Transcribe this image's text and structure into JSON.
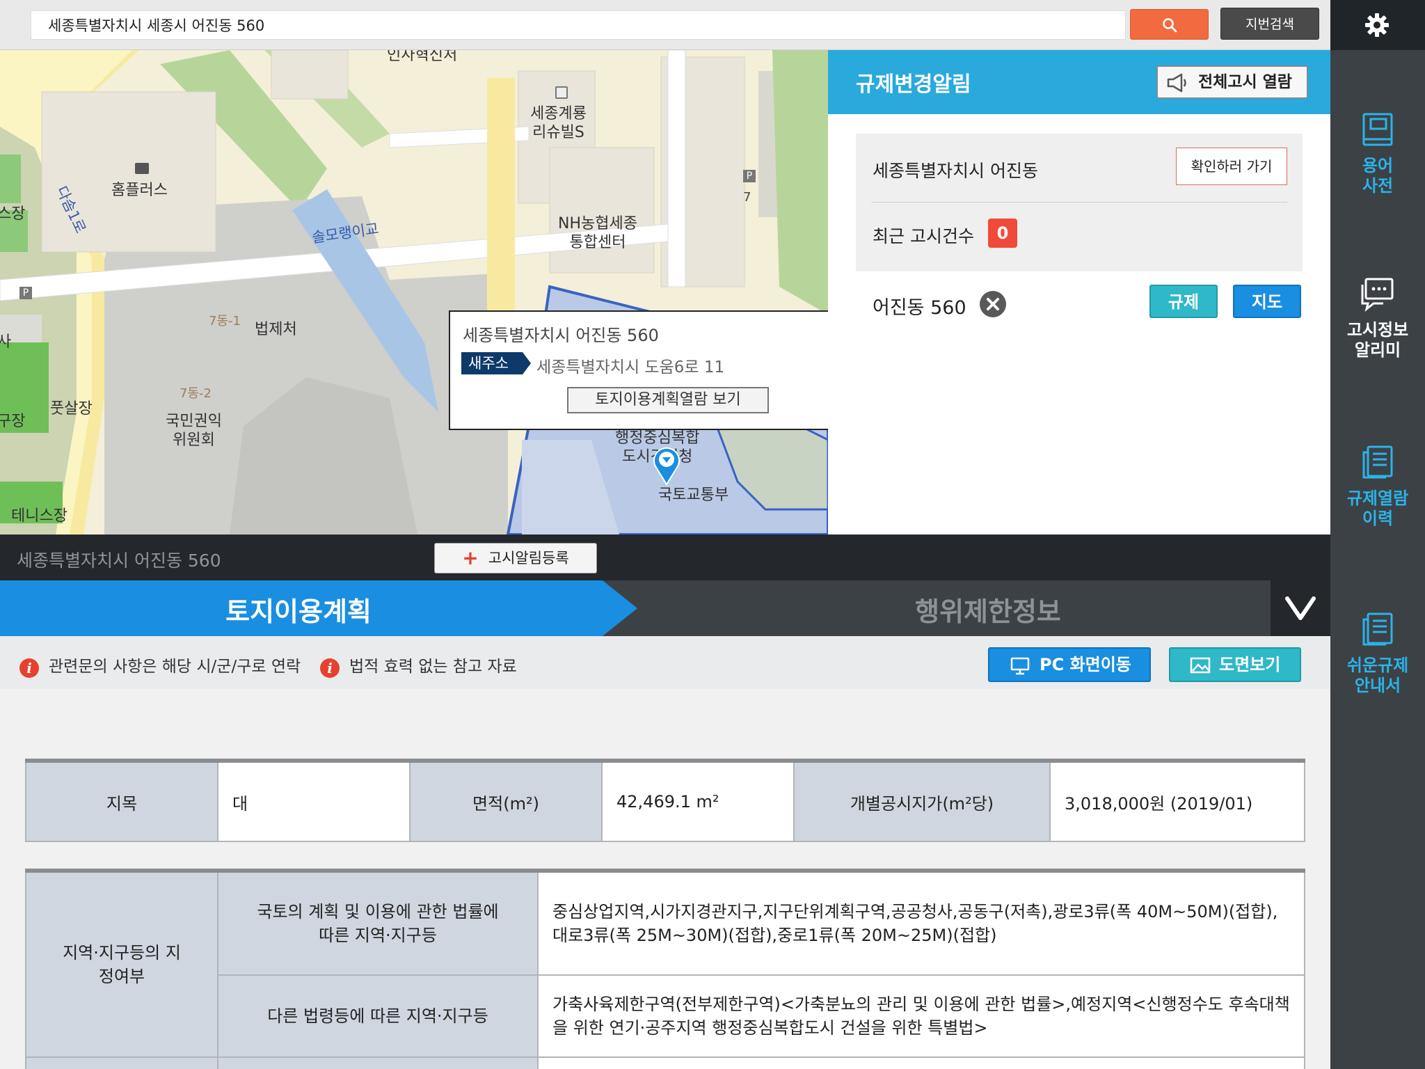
{
  "search": {
    "value": "세종특별자치시 세종시 어진동 560",
    "lot_search_label": "지번검색"
  },
  "right_nav": {
    "items": [
      {
        "label": "용어\n사전",
        "icon": "book-icon"
      },
      {
        "label": "고시정보\n알리미",
        "icon": "speech-bubble-icon"
      },
      {
        "label": "규제열람\n이력",
        "icon": "document-list-icon"
      },
      {
        "label": "쉬운규제\n안내서",
        "icon": "guide-book-icon"
      }
    ]
  },
  "map": {
    "labels": {
      "insa": "인사혁신처",
      "sejong_gyeryong": "세종계룡\n리슈빌S",
      "homeplus": "홈플러스",
      "dasom": "다솜1로",
      "solmorang": "솔모랭이교",
      "nh": "NH농협세종\n통합센터",
      "p7": "7",
      "dong71": "7동-1",
      "moleg": "법제처",
      "dong72": "7동-2",
      "acrc": "국민권익\n위원회",
      "futsal": "풋살장",
      "tennis": "테니스장",
      "molit": "국토교통부",
      "naacc": "행정중심복합\n도시건설청",
      "left_edge1": "스장",
      "left_edge2": "사",
      "left_edge3": "구장"
    },
    "popup": {
      "title": "세종특별자치시 어진동 560",
      "new_address_badge": "새주소",
      "new_address": "세종특별자치시 도움6로 11",
      "view_button": "토지이용계획열람 보기"
    }
  },
  "panel": {
    "title": "규제변경알림",
    "all_notice_button": "전체고시 열람",
    "region_name": "세종특별자치시 어진동",
    "go_check_button": "확인하러 가기",
    "recent_label": "최근 고시건수",
    "recent_count": "0",
    "address": "어진동 560",
    "regulation_button": "규제",
    "map_button": "지도"
  },
  "address_bar": {
    "text": "세종특별자치시 어진동 560",
    "register_button": "고시알림등록"
  },
  "tabs": {
    "land_use": "토지이용계획",
    "activity_limit": "행위제한정보"
  },
  "notes": {
    "note1": "관련문의 사항은 해당 시/군/구로 연락",
    "note2": "법적 효력 없는 참고 자료",
    "pc_button": "PC 화면이동",
    "drawing_button": "도면보기"
  },
  "land_table": {
    "jimok_label": "지목",
    "jimok_value": "대",
    "area_label": "면적(m²)",
    "area_value": "42,469.1 m²",
    "price_label": "개별공시지가(m²당)",
    "price_value": "3,018,000원 (2019/01)"
  },
  "zone_table": {
    "group_label": "지역·지구등의 지\n정여부",
    "row1_label": "국토의 계획 및 이용에 관한 법률에\n따른 지역·지구등",
    "row1_value": "중심상업지역,시가지경관지구,지구단위계획구역,공공청사,공동구(저촉),광로3류(폭 40M~50M)(접합),\n대로3류(폭 25M~30M)(접합),중로1류(폭 20M~25M)(접합)",
    "row2_label": "다른 법령등에 따른 지역·지구등",
    "row2_value": "가축사육제한구역(전부제한구역)<가축분뇨의 관리 및 이용에 관한 법률>,예정지역<신행정수도 후속대책\n을 위한 연기·공주지역 행정중심복합도시 건설을 위한 특별법>"
  },
  "colors": {
    "accent_blue": "#2aa9dd",
    "tab_blue": "#1a8ee0",
    "teal": "#2fb8c8",
    "alert_red": "#f04a3a",
    "search_orange": "#f26a3f",
    "sidebar_dark": "#3c4146"
  }
}
